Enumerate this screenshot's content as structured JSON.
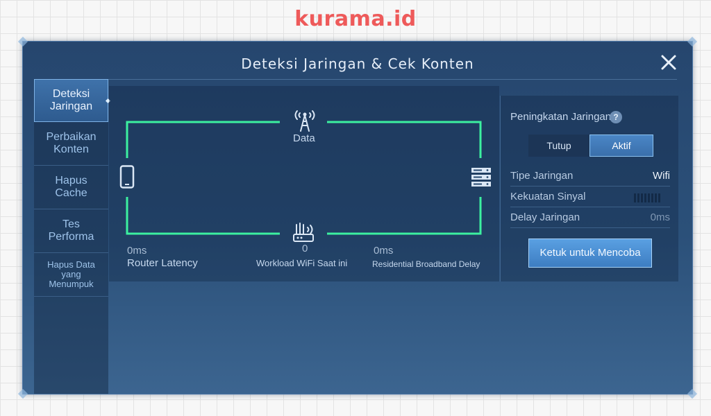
{
  "watermark": "kurama.id",
  "dialog": {
    "title": "Deteksi Jaringan & Cek Konten"
  },
  "sidebar": {
    "items": [
      {
        "label": "Deteksi\nJaringan",
        "active": true
      },
      {
        "label": "Perbaikan\nKonten",
        "active": false
      },
      {
        "label": "Hapus\nCache",
        "active": false
      },
      {
        "label": "Tes\nPerforma",
        "active": false
      },
      {
        "label": "Hapus Data\nyang\nMenumpuk",
        "active": false
      }
    ]
  },
  "network": {
    "data_label": "Data",
    "router_latency": {
      "value": "0ms",
      "label": "Router Latency"
    },
    "wifi_workload": {
      "value": "0",
      "label": "Workload WiFi Saat ini"
    },
    "broadband_delay": {
      "value": "0ms",
      "label": "Residential Broadband Delay"
    },
    "icons": {
      "top": "cell-tower-icon",
      "left": "phone-icon",
      "right": "server-icon",
      "bottom": "router-icon"
    },
    "line_color": "#3cf0a0"
  },
  "right_panel": {
    "boost_label": "Peningkatan Jaringan",
    "help_symbol": "?",
    "toggle": {
      "off": "Tutup",
      "on": "Aktif",
      "selected": "Aktif"
    },
    "rows": [
      {
        "label": "Tipe Jaringan",
        "value": "Wifi"
      },
      {
        "label": "Kekuatan Sinyal",
        "value": ""
      },
      {
        "label": "Delay Jaringan",
        "value": "0ms"
      }
    ],
    "signal_bars": 0,
    "button": "Ketuk untuk Mencoba"
  },
  "colors": {
    "accent": "#4a86c6",
    "panel_bg": "#26466e",
    "watermark": "#ee5a5a"
  }
}
